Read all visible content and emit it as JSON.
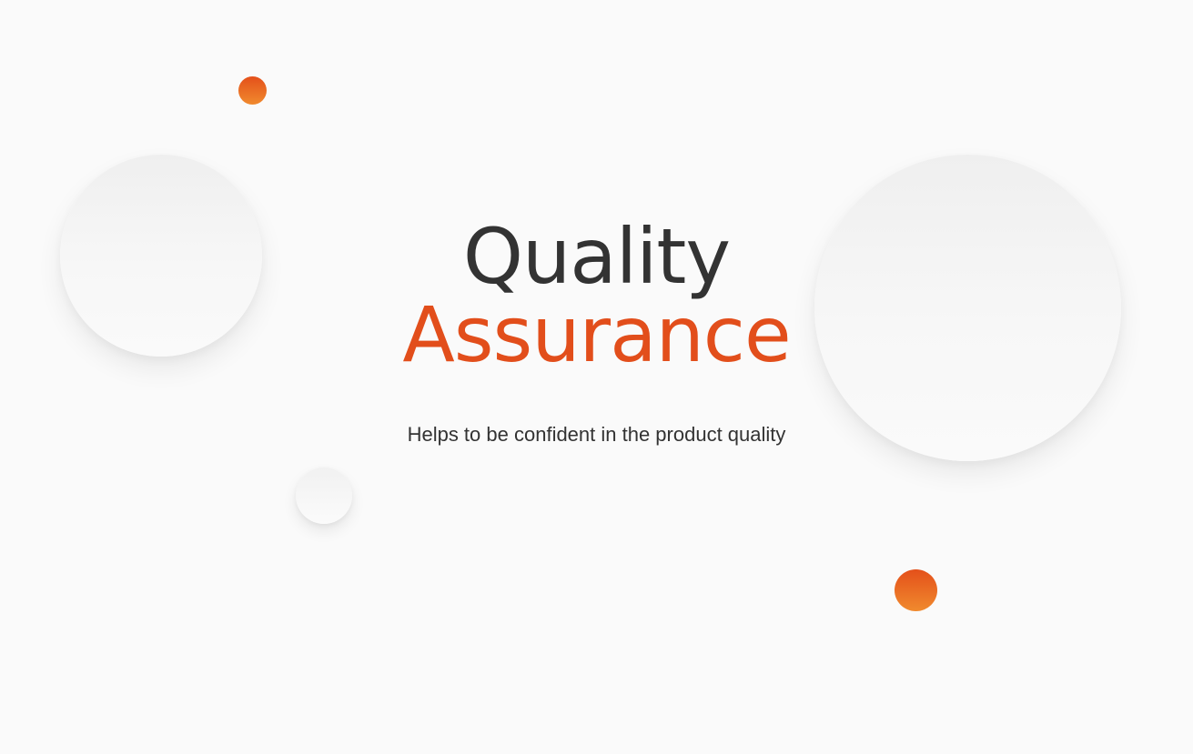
{
  "hero": {
    "title_line1": "Quality",
    "title_line2": "Assurance",
    "subtitle": "Helps to be confident in the product quality"
  },
  "colors": {
    "background": "#fafafa",
    "text_dark": "#333333",
    "accent": "#e24e1b",
    "accent_gradient_end": "#f08a2e"
  },
  "icons": {
    "decoration_large_left": "bubble-large-circle",
    "decoration_large_right": "bubble-large-circle",
    "decoration_small": "bubble-small-circle",
    "decoration_dots": "orange-dot"
  }
}
